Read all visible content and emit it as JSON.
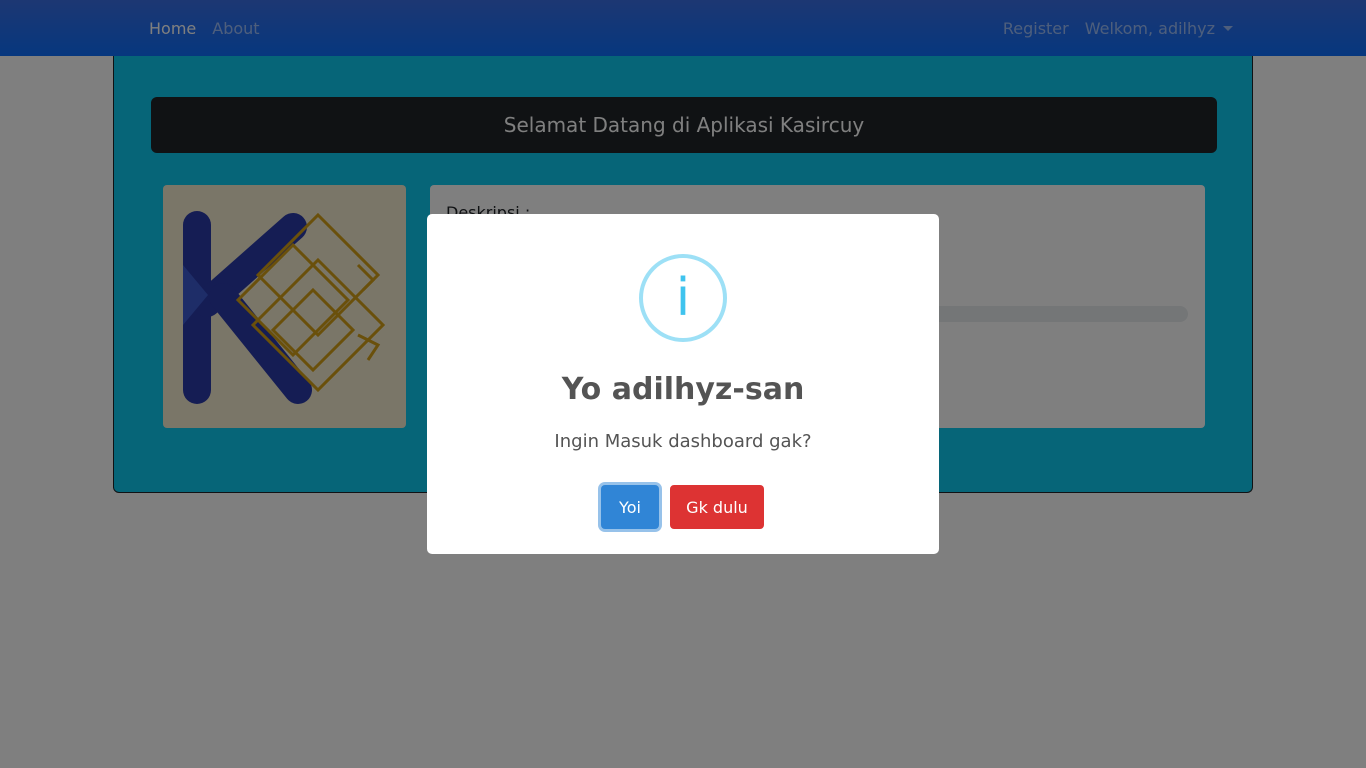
{
  "navbar": {
    "home_label": "Home",
    "about_label": "About",
    "register_label": "Register",
    "user_menu_label": "Welkom, adilhyz"
  },
  "main": {
    "welcome_text": "Selamat Datang di Aplikasi Kasircuy",
    "logo_icon": "kasircuy-logo",
    "description_label": "Deskripsi :"
  },
  "modal": {
    "icon": "info-icon",
    "icon_glyph": "i",
    "title": "Yo adilhyz-san",
    "text": "Ingin Masuk dashboard gak?",
    "confirm_label": "Yoi",
    "cancel_label": "Gk dulu"
  },
  "colors": {
    "navbar": "#0d6efd",
    "card": "#0dcaf0",
    "confirm": "#3085d6",
    "cancel": "#dd3333",
    "info": "#3fc3ee"
  }
}
